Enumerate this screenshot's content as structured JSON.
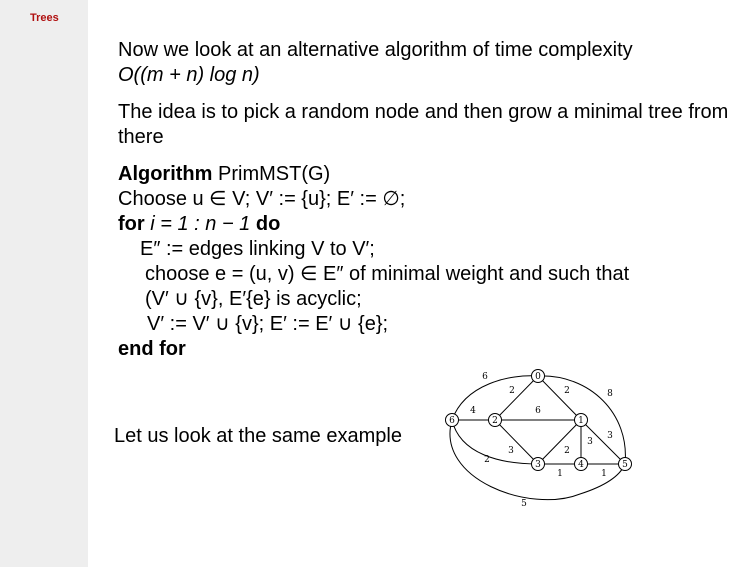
{
  "sidebar": {
    "section_title": "Trees"
  },
  "intro": {
    "line1": "Now we look at an alternative algorithm of time complexity",
    "complexity": "O((m + n) log n)",
    "idea": "The idea is to pick a random node and then grow a minimal tree from there"
  },
  "algorithm": {
    "keyword": "Algorithm",
    "name": "PrimMST(G)",
    "line_choose": "Choose u ∈ V; V′ := {u}; E′ := ∅;",
    "for_keyword": "for",
    "for_range": "i = 1 : n − 1",
    "do_keyword": "do",
    "line_edges": "E″ := edges linking V to V′;",
    "line_choose_e": "choose e = (u, v) ∈ E″ of minimal weight and such that",
    "line_acyclic": "(V′ ∪ {v}, E′{e} is acyclic;",
    "line_update": "V′ := V′ ∪ {v}; E′ := E′ ∪ {e};",
    "end_for": "end for"
  },
  "example_text": "Let us look at the same example",
  "graph": {
    "nodes": [
      {
        "id": "n0",
        "label": "0"
      },
      {
        "id": "n1",
        "label": "1"
      },
      {
        "id": "n2",
        "label": "2"
      },
      {
        "id": "n3",
        "label": "3"
      },
      {
        "id": "n4",
        "label": "4"
      },
      {
        "id": "n5",
        "label": "5"
      },
      {
        "id": "n6",
        "label": "6"
      }
    ],
    "edges": [
      {
        "from": "n6",
        "to": "n0",
        "weight": "6"
      },
      {
        "from": "n6",
        "to": "n2",
        "weight": "4"
      },
      {
        "from": "n6",
        "to": "n3",
        "weight": "2"
      },
      {
        "from": "n6",
        "to": "n5",
        "weight": "5"
      },
      {
        "from": "n2",
        "to": "n0",
        "weight": "2"
      },
      {
        "from": "n0",
        "to": "n1",
        "weight": "2"
      },
      {
        "from": "n0",
        "to": "n5",
        "weight": "8"
      },
      {
        "from": "n2",
        "to": "n1",
        "weight": "6"
      },
      {
        "from": "n2",
        "to": "n3",
        "weight": "3"
      },
      {
        "from": "n1",
        "to": "n3",
        "weight": "2"
      },
      {
        "from": "n1",
        "to": "n4",
        "weight": "3"
      },
      {
        "from": "n1",
        "to": "n5",
        "weight": "3"
      },
      {
        "from": "n3",
        "to": "n4",
        "weight": "1"
      },
      {
        "from": "n4",
        "to": "n5",
        "weight": "1"
      }
    ]
  }
}
